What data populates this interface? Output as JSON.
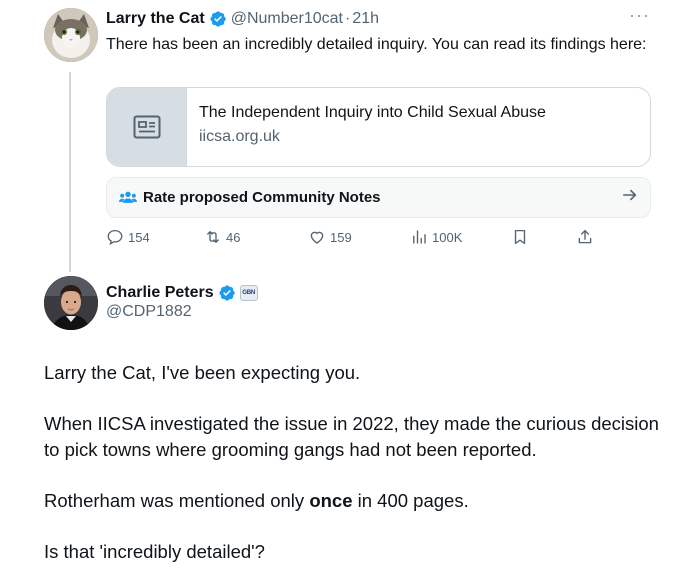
{
  "tweet1": {
    "author_name": "Larry the Cat",
    "handle": "@Number10cat",
    "separator": "·",
    "time": "21h",
    "text": "There has been an incredibly detailed inquiry. You can read its findings here:",
    "card": {
      "title": "The Independent Inquiry into Child Sexual Abuse",
      "domain": "iicsa.org.uk"
    },
    "community_notes_label": "Rate proposed Community Notes",
    "actions": {
      "replies": "154",
      "reposts": "46",
      "likes": "159",
      "views": "100K"
    }
  },
  "tweet2": {
    "author_name": "Charlie Peters",
    "handle": "@CDP1882",
    "affiliate_badge": "GBN",
    "paragraphs": {
      "p1": "Larry the Cat, I've been expecting you.",
      "p2": "When IICSA investigated the issue in 2022, they made the curious decision to pick towns where grooming gangs had not been reported.",
      "p3_before": "Rotherham was mentioned only ",
      "p3_bold": "once",
      "p3_after": " in 400 pages.",
      "p4": "Is that 'incredibly detailed'?"
    }
  },
  "colors": {
    "verified_blue": "#1d9bf0",
    "secondary_text": "#536471",
    "thread_line": "#cfd9de"
  },
  "icons": [
    "verified-badge-icon",
    "more-icon",
    "article-icon",
    "community-notes-icon",
    "arrow-right-icon",
    "reply-icon",
    "repost-icon",
    "like-icon",
    "views-icon",
    "bookmark-icon",
    "share-icon"
  ]
}
